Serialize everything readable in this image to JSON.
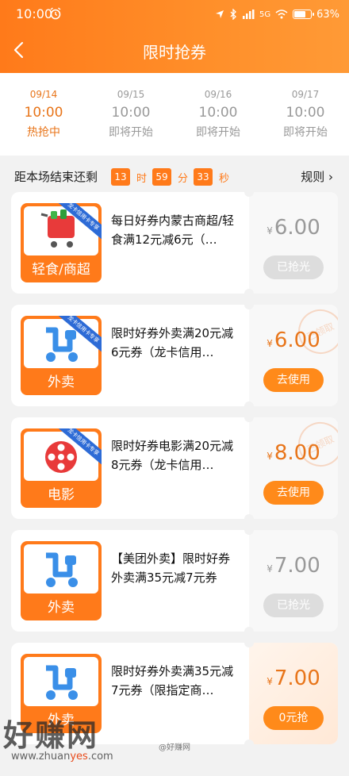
{
  "status_bar": {
    "time": "10:00",
    "network": "5G",
    "battery": "63%",
    "battery_level": 0.63
  },
  "nav": {
    "title": "限时抢券"
  },
  "date_tabs": [
    {
      "date": "09/14",
      "time": "10:00",
      "status": "热抢中"
    },
    {
      "date": "09/15",
      "time": "10:00",
      "status": "即将开始"
    },
    {
      "date": "09/16",
      "time": "10:00",
      "status": "即将开始"
    },
    {
      "date": "09/17",
      "time": "10:00",
      "status": "即将开始"
    }
  ],
  "countdown": {
    "label": "距本场结束还剩",
    "hours": "13",
    "h_unit": "时",
    "minutes": "59",
    "m_unit": "分",
    "seconds": "33",
    "s_unit": "秒",
    "rules": "规则"
  },
  "coupons": [
    {
      "category": "轻食/商超",
      "ribbon": "龙卡信用卡专享",
      "desc": "每日好券内蒙古商超/轻食满12元减6元（…",
      "currency": "¥",
      "price": "6.00",
      "button": "已抢光",
      "claimed_stamp": ""
    },
    {
      "category": "外卖",
      "ribbon": "龙卡信用卡专享",
      "desc": "限时好券外卖满20元减6元券（龙卡信用…",
      "currency": "¥",
      "price": "6.00",
      "button": "去使用",
      "claimed_stamp": "已领取"
    },
    {
      "category": "电影",
      "ribbon": "龙卡信用卡专享",
      "desc": "限时好券电影满20元减8元券（龙卡信用…",
      "currency": "¥",
      "price": "8.00",
      "button": "去使用",
      "claimed_stamp": "已领取"
    },
    {
      "category": "外卖",
      "ribbon": "",
      "desc": "【美团外卖】限时好券外卖满35元减7元券",
      "currency": "¥",
      "price": "7.00",
      "button": "已抢光",
      "claimed_stamp": ""
    },
    {
      "category": "外卖",
      "ribbon": "",
      "desc": "限时好券外卖满35元减7元券（限指定商…",
      "currency": "¥",
      "price": "7.00",
      "button": "0元抢",
      "claimed_stamp": ""
    }
  ],
  "watermark": {
    "brand": "好赚网",
    "url_prefix": "www.zhuan",
    "url_mid": "yes",
    "url_suffix": ".com",
    "weibo": "@好赚网"
  },
  "colors": {
    "accent": "#ff7a1a",
    "price_active": "#e8751a",
    "disabled": "#dddddd"
  }
}
